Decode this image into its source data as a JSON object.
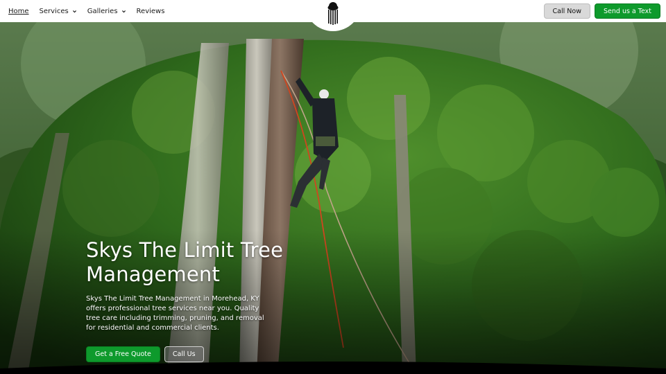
{
  "header": {
    "nav": [
      {
        "label": "Home"
      },
      {
        "label": "Services"
      },
      {
        "label": "Galleries"
      },
      {
        "label": "Reviews"
      }
    ],
    "call_now_label": "Call Now",
    "send_text_label": "Send us a Text"
  },
  "hero": {
    "title": "Skys The Limit Tree Management",
    "description": "Skys The Limit Tree Management in Morehead, KY offers professional tree services near you. Quality tree care including trimming, pruning, and removal for residential and commercial clients.",
    "quote_button": "Get a Free Quote",
    "call_button": "Call Us"
  },
  "colors": {
    "accent_green": "#0e9a2c",
    "header_bg": "#ffffff"
  },
  "icons": [
    "chevron-down-icon",
    "logo-tree-icon"
  ]
}
